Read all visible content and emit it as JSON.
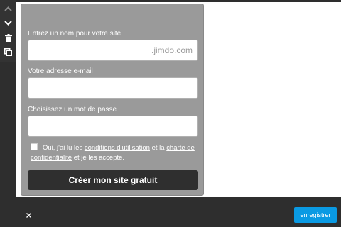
{
  "toolbar": {
    "icons": [
      "chevron-up-icon",
      "chevron-down-icon",
      "trash-icon",
      "copy-icon"
    ]
  },
  "form": {
    "site_name": {
      "label": "Entrez un nom pour votre site",
      "placeholder": ".jimdo.com"
    },
    "email": {
      "label": "Votre adresse e-mail",
      "placeholder": ""
    },
    "password": {
      "label": "Choisissez un mot de passe",
      "placeholder": ""
    },
    "terms": {
      "prefix": "Oui, j'ai lu les",
      "link1": "conditions d'utilisation",
      "middle": "et la",
      "link2": "charte de confidentialité",
      "suffix": "et je les accepte."
    },
    "submit_label": "Créer mon site gratuit"
  },
  "footer": {
    "close_symbol": "×",
    "save_label": "enregistrer"
  },
  "colors": {
    "accent": "#0a9ae3",
    "panel": "#9a9a9a",
    "dark": "#2e2e2e"
  }
}
